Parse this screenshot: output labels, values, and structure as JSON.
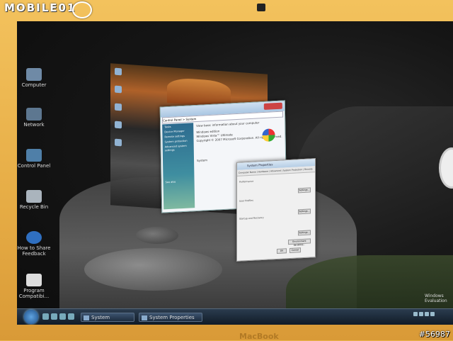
{
  "bezel": {
    "watermark_brand": "MOBILE01",
    "model_label": "MacBook",
    "photo_tag": "#56987"
  },
  "desktop": {
    "icons": [
      {
        "label": "Computer",
        "icon": "computer-icon"
      },
      {
        "label": "Network",
        "icon": "network-icon"
      },
      {
        "label": "Control Panel",
        "icon": "control-panel-icon"
      },
      {
        "label": "Recycle Bin",
        "icon": "recycle-bin-icon"
      },
      {
        "label": "How to Share Feedback",
        "icon": "help-icon"
      },
      {
        "label": "Program Compatibi...",
        "icon": "document-icon"
      }
    ],
    "watermark": [
      "Windows",
      "Evaluation"
    ]
  },
  "windows": {
    "system": {
      "address": "Control Panel > System",
      "heading": "View basic information about your computer",
      "sidebar_tasks": [
        "Tasks",
        "Device Manager",
        "Remote settings",
        "System protection",
        "Advanced system settings"
      ],
      "section_edition": "Windows edition",
      "edition_name": "Windows Vista™ Ultimate",
      "copyright": "Copyright © 2007 Microsoft Corporation. All rights reserved.",
      "section_system": "System",
      "see_also": "See also"
    },
    "system_properties": {
      "title": "System Properties",
      "tabs": [
        "Computer Name",
        "Hardware",
        "Advanced",
        "System Protection",
        "Remote"
      ],
      "sections": [
        "Performance",
        "User Profiles",
        "Startup and Recovery"
      ],
      "settings_label": "Settings...",
      "env_vars_label": "Environment Variables...",
      "ok_label": "OK",
      "cancel_label": "Cancel"
    }
  },
  "taskbar": {
    "buttons": [
      {
        "label": "System"
      },
      {
        "label": "System Properties"
      }
    ]
  }
}
